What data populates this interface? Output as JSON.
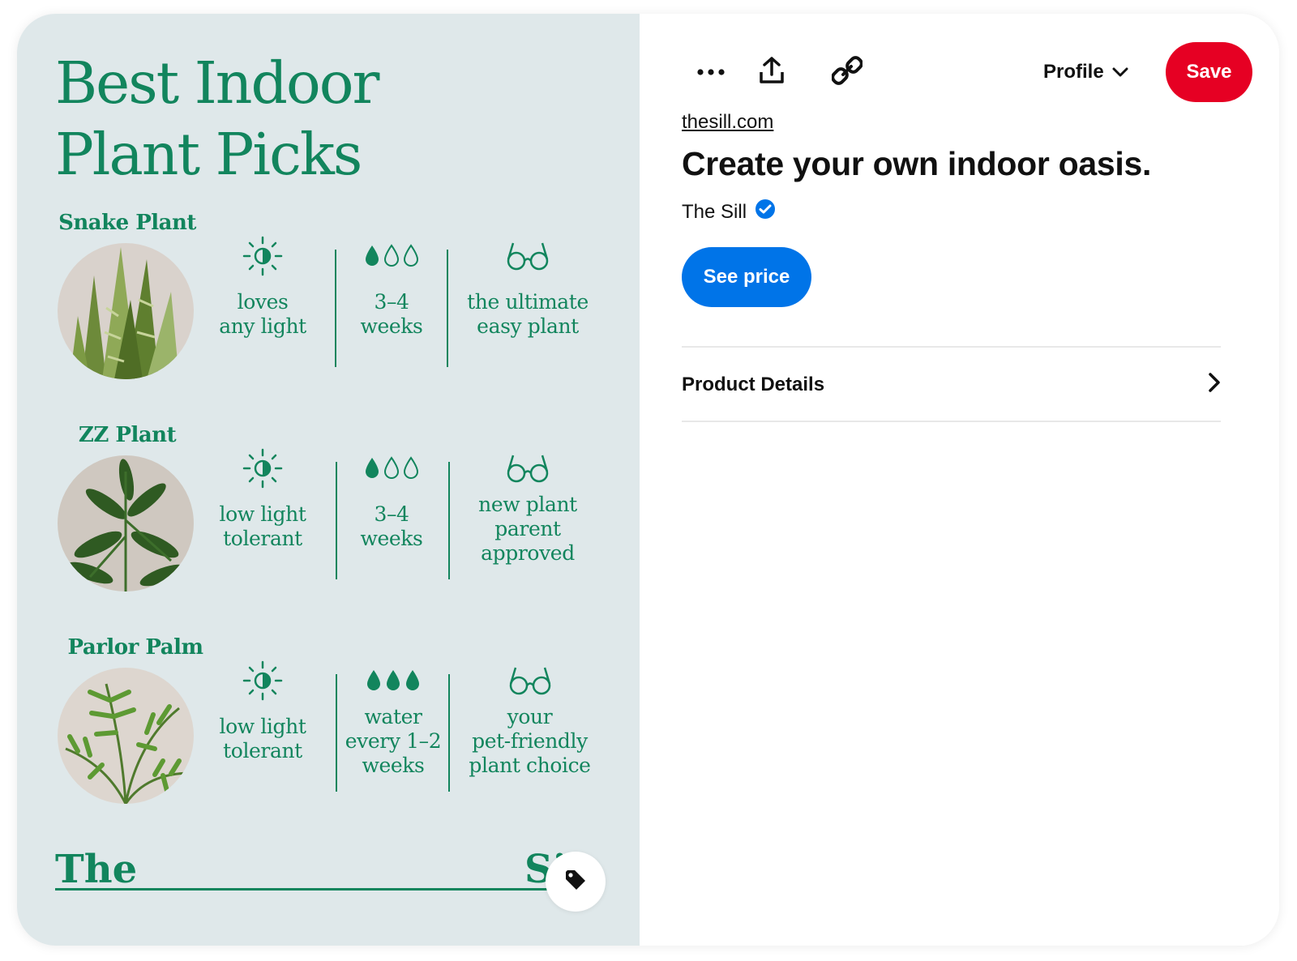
{
  "pin_image": {
    "title_line1": "Best Indoor",
    "title_line2": "Plant Picks",
    "accent_color": "#12855d",
    "plants": [
      {
        "name": "Snake Plant",
        "light": [
          "loves",
          "any light"
        ],
        "water_drops_filled": 1,
        "water": [
          "3–4",
          "weeks"
        ],
        "note": [
          "the ultimate",
          "easy plant"
        ]
      },
      {
        "name": "ZZ Plant",
        "light": [
          "low light",
          "tolerant"
        ],
        "water_drops_filled": 1,
        "water": [
          "3–4",
          "weeks"
        ],
        "note": [
          "new plant",
          "parent",
          "approved"
        ]
      },
      {
        "name": "Parlor Palm",
        "light": [
          "low light",
          "tolerant"
        ],
        "water_drops_filled": 3,
        "water": [
          "water",
          "every 1–2",
          "weeks"
        ],
        "note": [
          "your",
          "pet-friendly",
          "plant choice"
        ]
      }
    ],
    "brand_left": "The",
    "brand_right": "Si",
    "tag_icon": "tag-icon"
  },
  "toolbar": {
    "more_icon": "more-dots-icon",
    "share_icon": "share-upload-icon",
    "link_icon": "link-icon",
    "profile_label": "Profile",
    "save_label": "Save",
    "save_color": "#e60023"
  },
  "details": {
    "source": "thesill.com",
    "title": "Create your own indoor oasis.",
    "creator": "The Sill",
    "verified_icon": "verified-badge-icon",
    "see_price_label": "See price",
    "see_price_color": "#0074e8",
    "product_details_label": "Product Details"
  }
}
